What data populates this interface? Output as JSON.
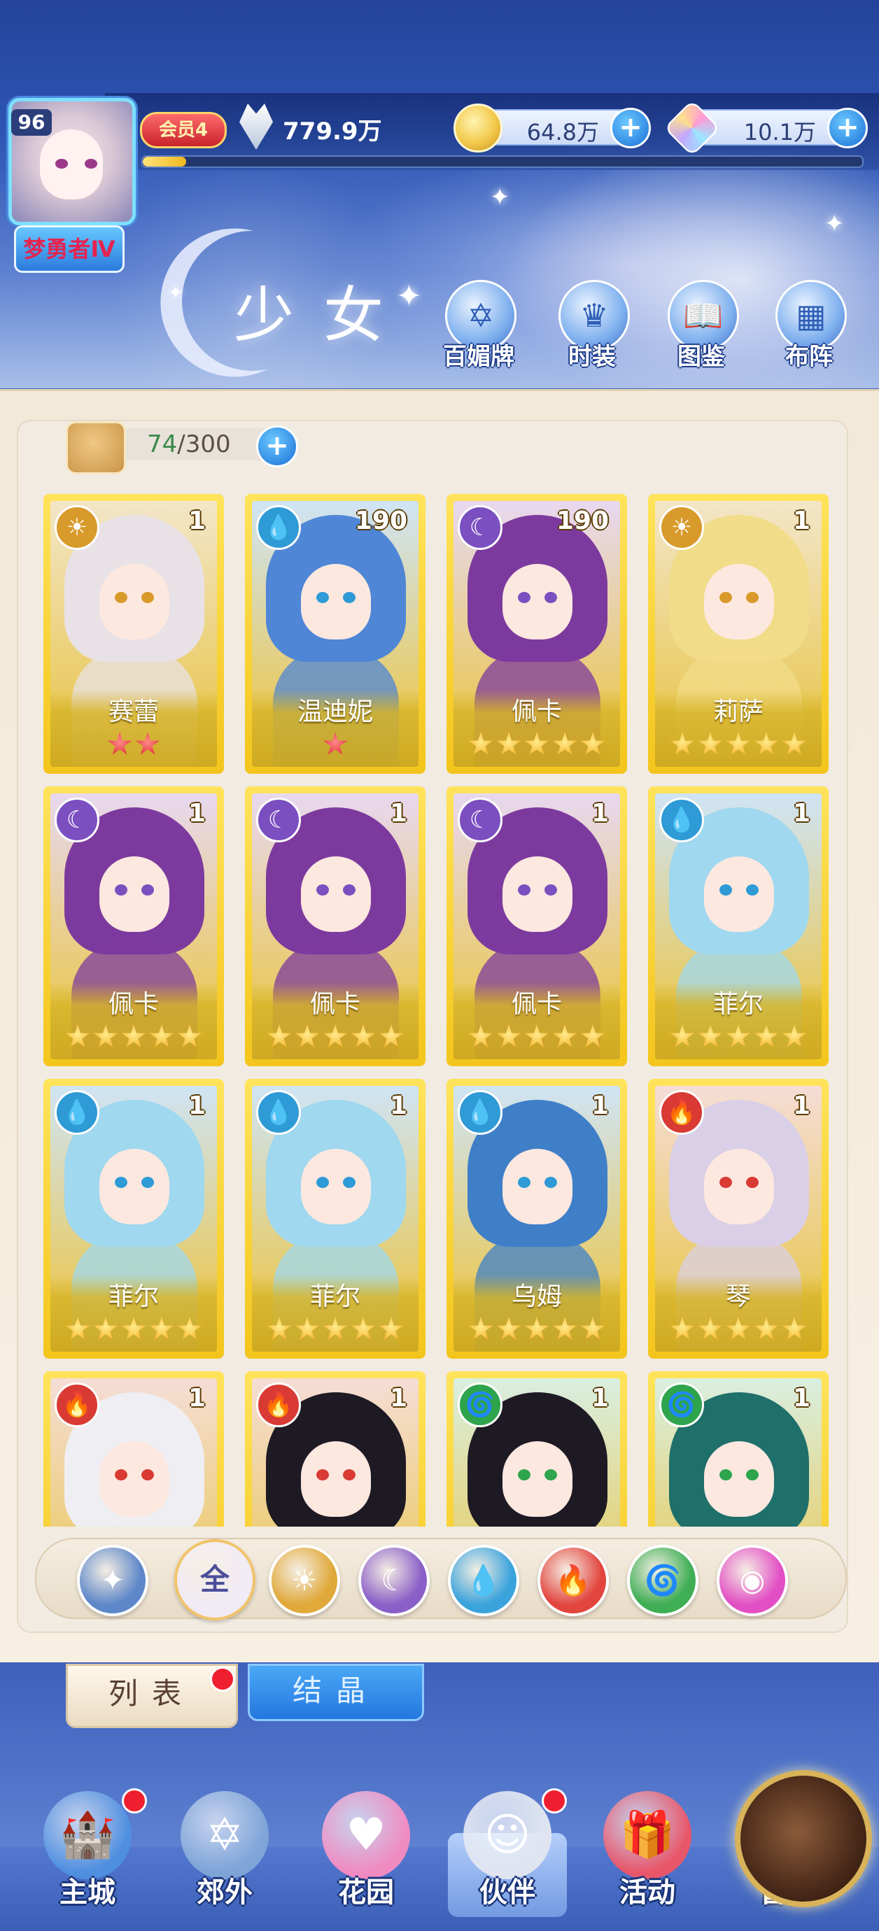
{
  "header": {
    "player_level": "96",
    "player_rank": "梦勇者Ⅳ",
    "vip_label": "会员4",
    "power": "779.9万",
    "exp_fraction": 0.06,
    "coins": "64.8万",
    "gems": "10.1万",
    "title": "少女",
    "menu": [
      {
        "label": "百媚牌",
        "icon": "hexagram-card-icon"
      },
      {
        "label": "时装",
        "icon": "outfit-icon"
      },
      {
        "label": "图鉴",
        "icon": "book-icon"
      },
      {
        "label": "布阵",
        "icon": "formation-grid-icon"
      }
    ]
  },
  "inventory": {
    "current": "74",
    "max": "/300",
    "plus": "+"
  },
  "cards": [
    {
      "name": "赛蕾",
      "count": "1",
      "element": "sun",
      "stars": 2,
      "star_color": "red",
      "hair": "#e8e2e6"
    },
    {
      "name": "温迪妮",
      "count": "190",
      "element": "water",
      "stars": 1,
      "star_color": "red",
      "hair": "#4f86d6"
    },
    {
      "name": "佩卡",
      "count": "190",
      "element": "moon",
      "stars": 5,
      "star_color": "gold",
      "hair": "#7d3a9e"
    },
    {
      "name": "莉萨",
      "count": "1",
      "element": "sun",
      "stars": 5,
      "star_color": "gold",
      "hair": "#f1dc8a"
    },
    {
      "name": "佩卡",
      "count": "1",
      "element": "moon",
      "stars": 5,
      "star_color": "gold",
      "hair": "#7d3a9e"
    },
    {
      "name": "佩卡",
      "count": "1",
      "element": "moon",
      "stars": 5,
      "star_color": "gold",
      "hair": "#7d3a9e"
    },
    {
      "name": "佩卡",
      "count": "1",
      "element": "moon",
      "stars": 5,
      "star_color": "gold",
      "hair": "#7d3a9e"
    },
    {
      "name": "菲尔",
      "count": "1",
      "element": "water",
      "stars": 5,
      "star_color": "gold",
      "hair": "#9fd8ef"
    },
    {
      "name": "菲尔",
      "count": "1",
      "element": "water",
      "stars": 5,
      "star_color": "gold",
      "hair": "#9fd8ef"
    },
    {
      "name": "菲尔",
      "count": "1",
      "element": "water",
      "stars": 5,
      "star_color": "gold",
      "hair": "#9fd8ef"
    },
    {
      "name": "乌姆",
      "count": "1",
      "element": "water",
      "stars": 5,
      "star_color": "gold",
      "hair": "#3f7fc8"
    },
    {
      "name": "琴",
      "count": "1",
      "element": "fire",
      "stars": 5,
      "star_color": "gold",
      "hair": "#d9cfe6"
    },
    {
      "name": "",
      "count": "1",
      "element": "fire",
      "stars": 0,
      "star_color": "gold",
      "hair": "#efeef2"
    },
    {
      "name": "",
      "count": "1",
      "element": "fire",
      "stars": 0,
      "star_color": "gold",
      "hair": "#1e1a24"
    },
    {
      "name": "",
      "count": "1",
      "element": "wind",
      "stars": 0,
      "star_color": "gold",
      "hair": "#1e1a24"
    },
    {
      "name": "",
      "count": "1",
      "element": "wind",
      "stars": 0,
      "star_color": "gold",
      "hair": "#1f6f6a"
    }
  ],
  "filters": [
    {
      "key": "collapse",
      "label": "",
      "color": "#5d87c9"
    },
    {
      "key": "all",
      "label": "全",
      "color": "#f1ebf6"
    },
    {
      "key": "sun",
      "label": "",
      "color": "#e0a93a"
    },
    {
      "key": "moon",
      "label": "",
      "color": "#8b5fc8"
    },
    {
      "key": "water",
      "label": "",
      "color": "#3aa3dc"
    },
    {
      "key": "fire",
      "label": "",
      "color": "#e2453e"
    },
    {
      "key": "wind",
      "label": "",
      "color": "#3fae55"
    },
    {
      "key": "star",
      "label": "",
      "color": "#e24fc5"
    }
  ],
  "tabs": {
    "list": "列表",
    "crystal": "结晶"
  },
  "nav": [
    {
      "label": "主城",
      "icon": "castle-icon",
      "badge": true,
      "active": false
    },
    {
      "label": "郊外",
      "icon": "portal-icon",
      "badge": false,
      "active": false
    },
    {
      "label": "花园",
      "icon": "heart-icon",
      "badge": false,
      "active": false
    },
    {
      "label": "伙伴",
      "icon": "partner-icon",
      "badge": true,
      "active": true
    },
    {
      "label": "活动",
      "icon": "gift-icon",
      "badge": false,
      "active": false
    },
    {
      "label": "冒险",
      "icon": "compass-icon",
      "badge": false,
      "active": false
    }
  ],
  "element_colors": {
    "sun": "#d89a2a",
    "moon": "#7b4fc0",
    "water": "#2e9ad6",
    "fire": "#d93a34",
    "wind": "#2ea44c"
  }
}
